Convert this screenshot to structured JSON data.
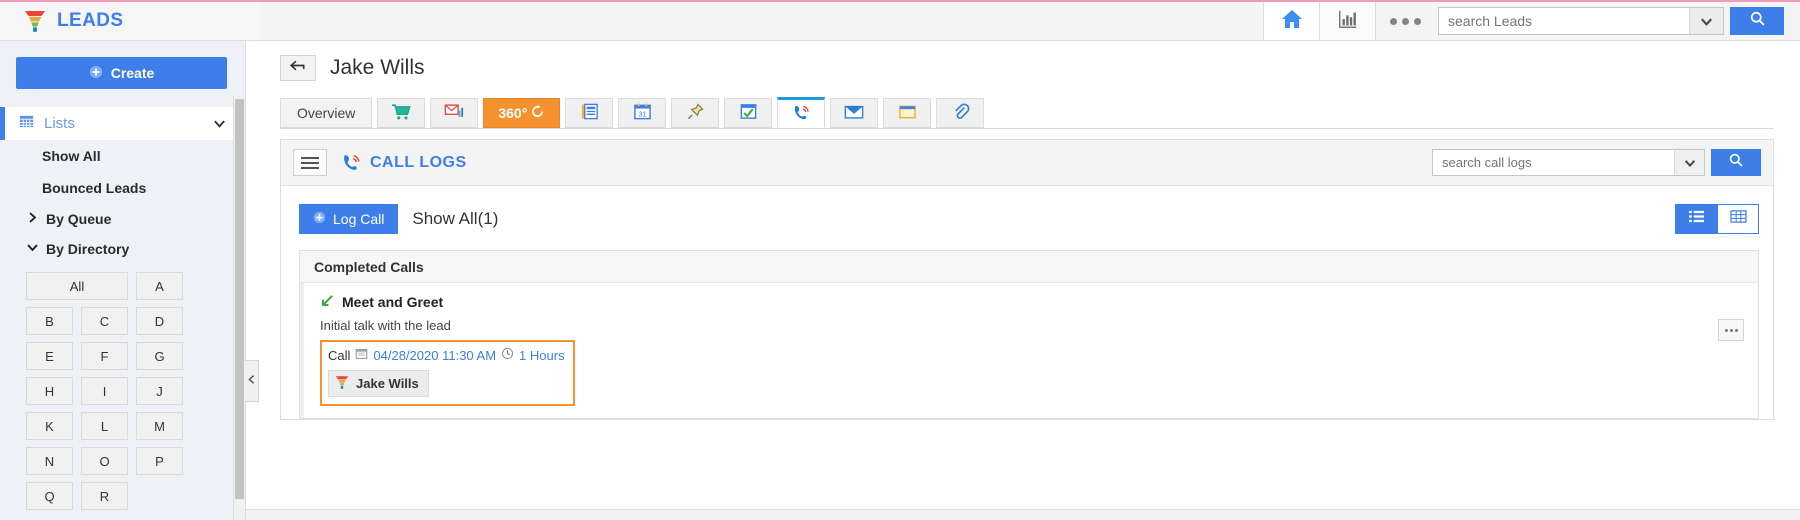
{
  "topbar": {
    "brand": "LEADS",
    "brand_color": "#3d7ee8",
    "logo_icon": "funnel-icon",
    "home_icon": "home-icon",
    "reports_icon": "bar-chart-icon",
    "more_icon": "three-dots-icon",
    "search_placeholder": "search Leads",
    "search_value": "",
    "search_button_icon": "magnifier-icon",
    "dropdown_icon": "chevron-down-icon"
  },
  "sidebar": {
    "create_label": "Create",
    "create_icon": "plus-circle-icon",
    "lists_label": "Lists",
    "lists_icon": "grid-icon",
    "lists_chevron": "chevron-down-icon",
    "links": [
      {
        "label": "Show All"
      },
      {
        "label": "Bounced Leads"
      }
    ],
    "groups": [
      {
        "label": "By Queue",
        "icon": "chevron-right-icon",
        "expanded": false
      },
      {
        "label": "By Directory",
        "icon": "chevron-down-icon",
        "expanded": true
      }
    ],
    "alphabet": [
      "All",
      "A",
      "B",
      "C",
      "D",
      "E",
      "F",
      "G",
      "H",
      "I",
      "J",
      "K",
      "L",
      "M",
      "N",
      "O",
      "P",
      "Q",
      "R"
    ],
    "collapse_icon": "chevron-left-icon"
  },
  "page": {
    "back_icon": "back-arrow-icon",
    "title": "Jake Wills"
  },
  "tabs": [
    {
      "label": "Overview",
      "icon": "",
      "type": "text",
      "active": false
    },
    {
      "label": "",
      "icon": "cart-icon",
      "type": "icon",
      "active": false
    },
    {
      "label": "",
      "icon": "mail-chart-icon",
      "type": "icon",
      "active": false
    },
    {
      "label": "360°",
      "icon": "refresh-icon",
      "type": "orange",
      "active": false
    },
    {
      "label": "",
      "icon": "notes-icon",
      "type": "icon",
      "active": false
    },
    {
      "label": "",
      "icon": "calendar-icon",
      "type": "icon",
      "active": false
    },
    {
      "label": "",
      "icon": "pin-icon",
      "type": "icon",
      "active": false
    },
    {
      "label": "",
      "icon": "task-check-icon",
      "type": "icon",
      "active": false
    },
    {
      "label": "",
      "icon": "phone-call-icon",
      "type": "icon",
      "active": true
    },
    {
      "label": "",
      "icon": "envelope-icon",
      "type": "icon",
      "active": false
    },
    {
      "label": "",
      "icon": "notepad-icon",
      "type": "icon",
      "active": false
    },
    {
      "label": "",
      "icon": "attachment-icon",
      "type": "icon",
      "active": false
    }
  ],
  "panel": {
    "menu_icon": "hamburger-icon",
    "title_icon": "phone-call-icon",
    "title": "CALL LOGS",
    "search_placeholder": "search call logs",
    "search_value": "",
    "search_button_icon": "magnifier-icon",
    "dropdown_icon": "chevron-down-icon"
  },
  "actions": {
    "log_call_label": "Log Call",
    "log_call_icon": "plus-circle-icon",
    "show_all_label": "Show All(1)",
    "view_list_icon": "list-view-icon",
    "view_grid_icon": "grid-view-icon",
    "active_view": "list"
  },
  "calls": {
    "section_label": "Completed Calls",
    "items": [
      {
        "direction_icon": "incoming-call-arrow-icon",
        "title": "Meet and Greet",
        "description": "Initial talk with the lead",
        "type_label": "Call",
        "date_icon": "calendar-icon",
        "datetime": "04/28/2020 11:30 AM",
        "duration_icon": "clock-icon",
        "duration": "1 Hours",
        "contact_icon": "funnel-icon",
        "contact": "Jake Wills",
        "menu_icon": "three-dots-icon",
        "highlight_color": "#f5922f"
      }
    ]
  }
}
